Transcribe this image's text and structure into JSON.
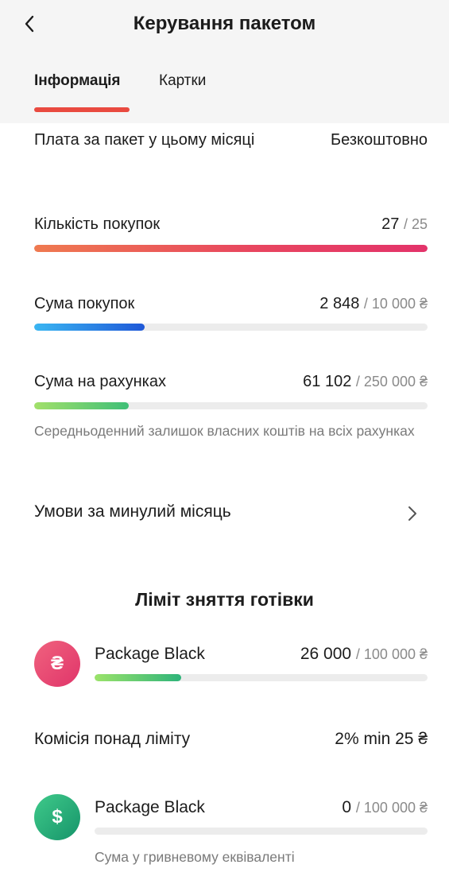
{
  "header": {
    "back_icon": "chevron-left-icon",
    "title": "Керування пакетом"
  },
  "tabs": [
    {
      "label": "Інформація",
      "active": true
    },
    {
      "label": "Картки",
      "active": false
    }
  ],
  "colors": {
    "accent": "#e94a40",
    "header_bg": "#f5f5f5",
    "track_bg": "#ececec"
  },
  "fee": {
    "label": "Плата за пакет у цьому місяці",
    "value": "Безкоштовно"
  },
  "purchases_count": {
    "label": "Кількість покупок",
    "current": "27",
    "limit": "/ 25",
    "progress": 1.0
  },
  "purchases_sum": {
    "label": "Сума покупок",
    "current": "2 848",
    "limit": "/ 10 000 ₴",
    "progress": 0.28
  },
  "accounts_sum": {
    "label": "Сума на рахунках",
    "current": "61 102",
    "limit": "/ 250 000 ₴",
    "progress": 0.24,
    "note": "Середньоденний залишок власних коштів на всіх рахунках"
  },
  "last_month": {
    "label": "Умови за минулий місяць",
    "icon": "chevron-right-icon"
  },
  "cash_limit": {
    "title": "Ліміт зняття готівки",
    "uah": {
      "icon_symbol": "₴",
      "icon": "hryvnia-icon",
      "name": "Package Black",
      "current": "26 000",
      "limit": "/ 100 000 ₴",
      "progress": 0.26
    },
    "commission": {
      "label": "Комісія понад ліміту",
      "value": "2% min 25 ₴"
    },
    "usd": {
      "icon_symbol": "$",
      "icon": "dollar-icon",
      "name": "Package Black",
      "current": "0",
      "limit": "/ 100 000 ₴",
      "progress": 0,
      "note": "Сума у гривневому еквіваленті"
    }
  }
}
